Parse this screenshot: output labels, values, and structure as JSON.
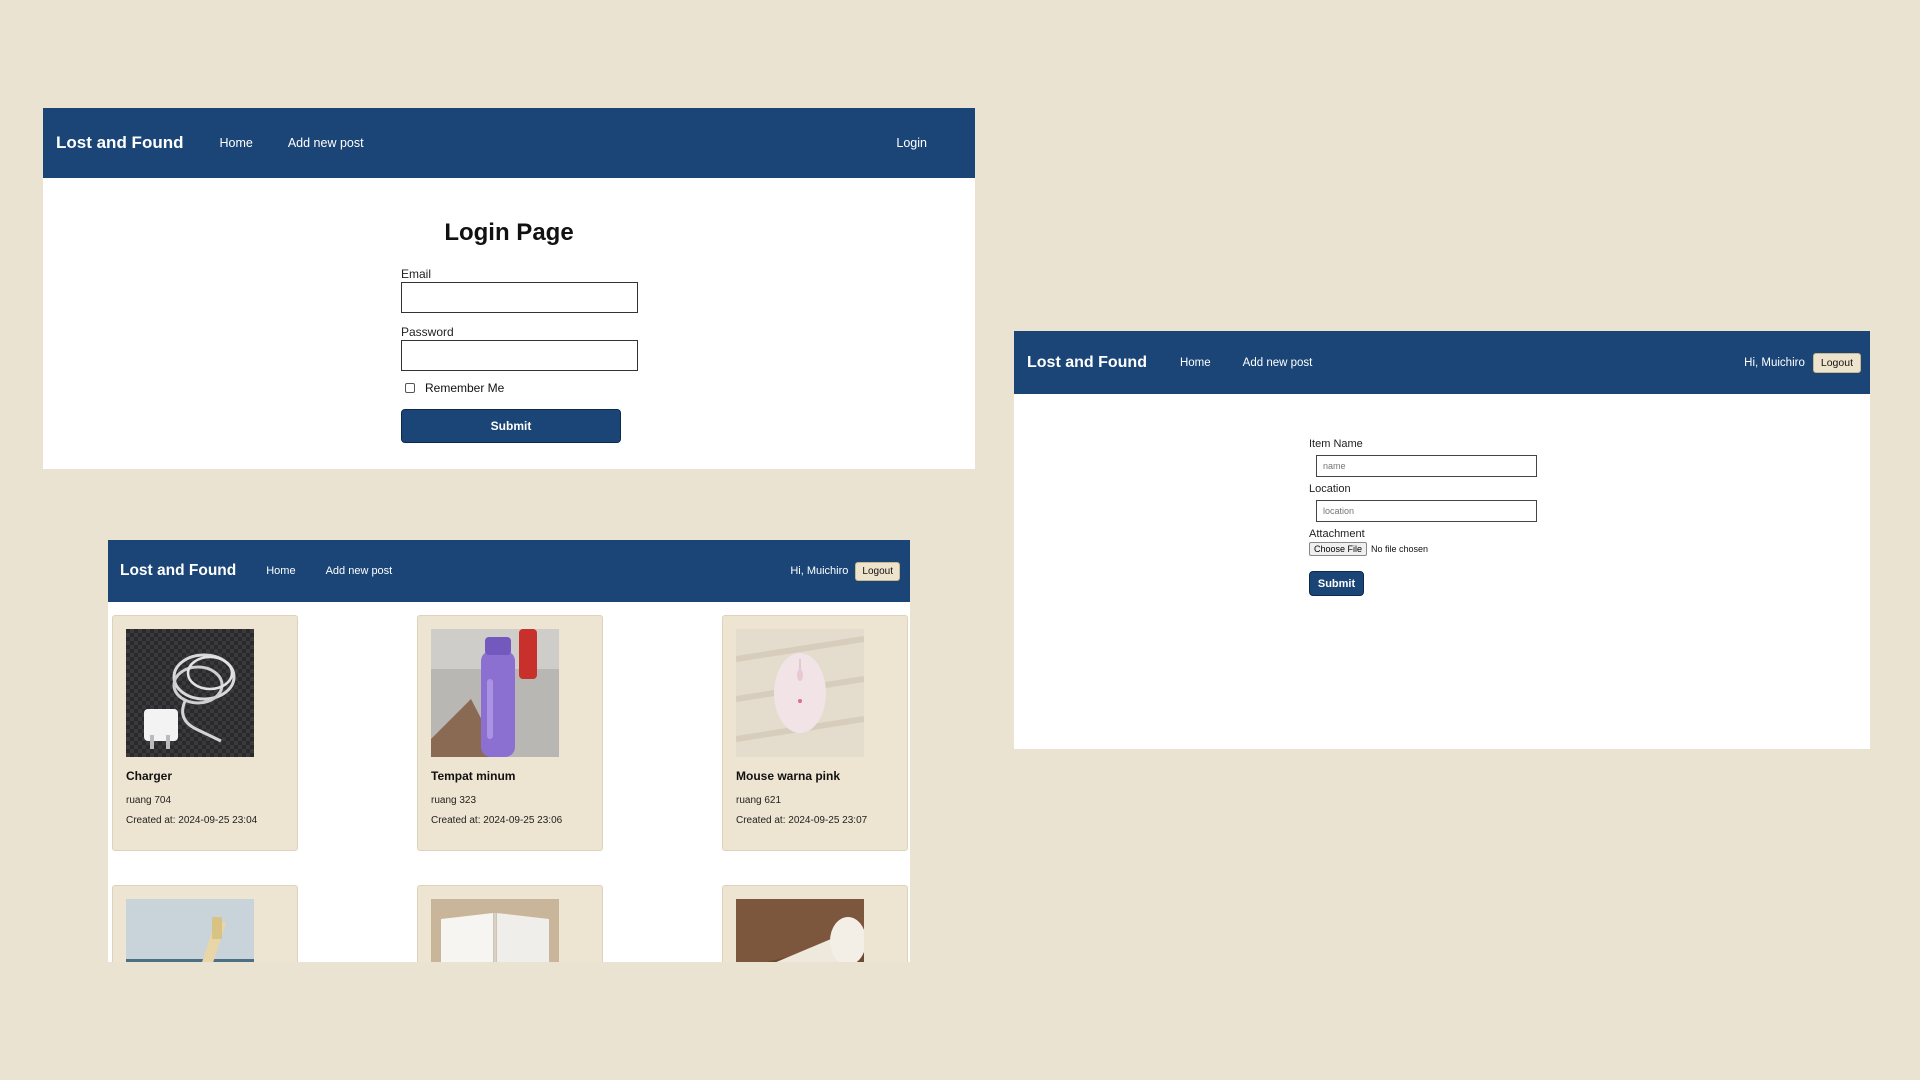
{
  "brand": "Lost and Found",
  "nav": {
    "home": "Home",
    "add_post": "Add new post"
  },
  "user": {
    "greeting": "Hi, Muichiro",
    "logout": "Logout"
  },
  "login_window": {
    "login_link": "Login",
    "title": "Login Page",
    "email_label": "Email",
    "password_label": "Password",
    "remember_label": "Remember Me",
    "submit": "Submit"
  },
  "add_window": {
    "item_name_label": "Item Name",
    "item_name_placeholder": "name",
    "location_label": "Location",
    "location_placeholder": "location",
    "attachment_label": "Attachment",
    "choose_file": "Choose File",
    "no_file": "No file chosen",
    "submit": "Submit"
  },
  "posts": [
    {
      "name": "Charger",
      "location": "ruang 704",
      "created": "Created at: 2024-09-25 23:04",
      "image": "charger-photo"
    },
    {
      "name": "Tempat minum",
      "location": "ruang 323",
      "created": "Created at: 2024-09-25 23:06",
      "image": "water-bottle-photo"
    },
    {
      "name": "Mouse warna pink",
      "location": "ruang 621",
      "created": "Created at: 2024-09-25 23:07",
      "image": "pink-mouse-photo"
    },
    {
      "image": "pen-photo"
    },
    {
      "image": "notebook-photo"
    },
    {
      "image": "usb-drive-photo"
    }
  ],
  "colors": {
    "navbar": "#1a4576",
    "page_bg": "#eae3d2",
    "card_bg": "#ede4d1",
    "logout_bg": "#eee3cc"
  }
}
